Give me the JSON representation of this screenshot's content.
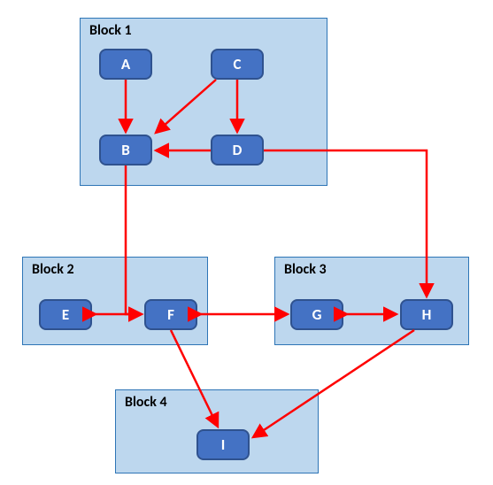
{
  "blocks": {
    "b1": {
      "label": "Block 1"
    },
    "b2": {
      "label": "Block 2"
    },
    "b3": {
      "label": "Block 3"
    },
    "b4": {
      "label": "Block 4"
    }
  },
  "nodes": {
    "A": "A",
    "B": "B",
    "C": "C",
    "D": "D",
    "E": "E",
    "F": "F",
    "G": "G",
    "H": "H",
    "I": "I"
  },
  "colors": {
    "block_fill": "#bdd7ee",
    "block_border": "#2e75b6",
    "node_fill": "#4472c4",
    "node_border": "#2f528f",
    "arrow": "#ff0000"
  },
  "edges": [
    {
      "from": "A",
      "to": "B",
      "type": "one"
    },
    {
      "from": "C",
      "to": "B",
      "type": "one"
    },
    {
      "from": "C",
      "to": "D",
      "type": "one"
    },
    {
      "from": "D",
      "to": "B",
      "type": "one"
    },
    {
      "from": "B",
      "to": "F",
      "type": "one"
    },
    {
      "from": "D",
      "to": "H",
      "type": "one"
    },
    {
      "from": "E",
      "to": "F",
      "type": "two"
    },
    {
      "from": "G",
      "to": "F",
      "type": "two"
    },
    {
      "from": "G",
      "to": "H",
      "type": "two"
    },
    {
      "from": "F",
      "to": "I",
      "type": "one"
    },
    {
      "from": "H",
      "to": "I",
      "type": "one"
    }
  ]
}
